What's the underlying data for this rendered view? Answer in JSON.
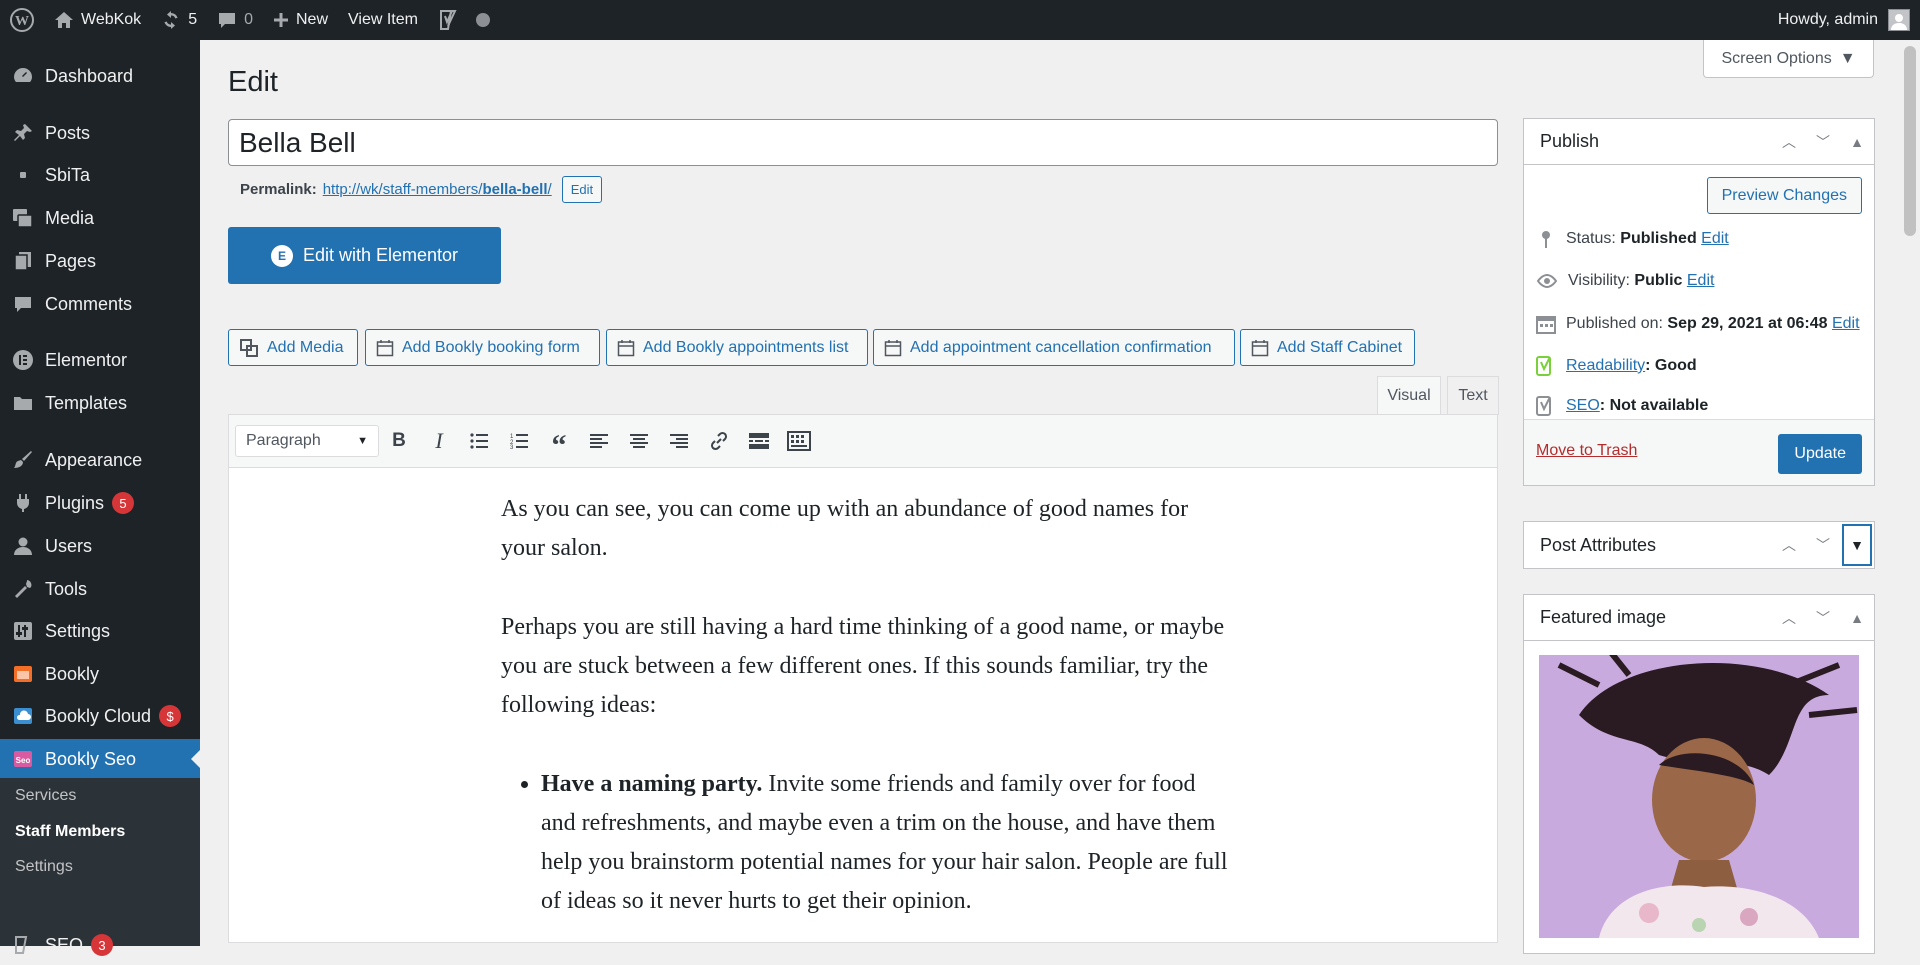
{
  "adminbar": {
    "site": "WebKok",
    "updates": "5",
    "comments": "0",
    "new_label": "New",
    "view_item": "View Item",
    "howdy": "Howdy, admin"
  },
  "sidebar": {
    "items": [
      {
        "label": "Dashboard",
        "icon": "dashboard-icon"
      },
      {
        "label": "Posts",
        "icon": "pin-icon"
      },
      {
        "label": "SbiTa",
        "icon": "dot-icon"
      },
      {
        "label": "Media",
        "icon": "media-icon"
      },
      {
        "label": "Pages",
        "icon": "pages-icon"
      },
      {
        "label": "Comments",
        "icon": "comment-icon"
      },
      {
        "label": "Elementor",
        "icon": "elementor-icon"
      },
      {
        "label": "Templates",
        "icon": "folder-icon"
      },
      {
        "label": "Appearance",
        "icon": "brush-icon"
      },
      {
        "label": "Plugins",
        "icon": "plug-icon",
        "badge": "5"
      },
      {
        "label": "Users",
        "icon": "user-icon"
      },
      {
        "label": "Tools",
        "icon": "wrench-icon"
      },
      {
        "label": "Settings",
        "icon": "settings-icon"
      },
      {
        "label": "Bookly",
        "icon": "bookly-icon"
      },
      {
        "label": "Bookly Cloud",
        "icon": "cloud-icon",
        "badge": "$"
      },
      {
        "label": "Bookly Seo",
        "icon": "seo-icon"
      },
      {
        "label": "SEO",
        "icon": "yoast-icon",
        "badge": "3"
      }
    ],
    "submenu": [
      "Services",
      "Staff Members",
      "Settings"
    ]
  },
  "main": {
    "screen_options": "Screen Options",
    "page_title": "Edit",
    "post_title": "Bella Bell",
    "permalink_label": "Permalink:",
    "permalink_base": "http://wk/staff-members/",
    "permalink_slug": "bella-bell",
    "permalink_end": "/",
    "permalink_edit": "Edit",
    "elementor_btn": "Edit with Elementor",
    "media_buttons": [
      "Add Media",
      "Add Bookly booking form",
      "Add Bookly appointments list",
      "Add appointment cancellation confirmation",
      "Add Staff Cabinet"
    ],
    "tab_visual": "Visual",
    "tab_text": "Text",
    "format_select": "Paragraph",
    "content": {
      "p1": "As you can see, you can come up with an abundance of good names for your salon.",
      "p2": "Perhaps you are still having a hard time thinking of a good name, or maybe you are stuck between a few different ones. If this sounds familiar, try the following ideas:",
      "li1_bold": "Have a naming party.",
      "li1_rest": " Invite some friends and family over for food and refreshments, and maybe even a trim on the house, and have them help you brainstorm potential names for your hair salon. People are full of ideas so it never hurts to get their opinion."
    }
  },
  "publish": {
    "title": "Publish",
    "preview": "Preview Changes",
    "status_label": "Status:",
    "status_value": "Published",
    "visibility_label": "Visibility:",
    "visibility_value": "Public",
    "published_label": "Published on:",
    "published_value": "Sep 29, 2021 at 06:48",
    "edit": "Edit",
    "readability_link": "Readability",
    "readability_value": ": Good",
    "seo_link": "SEO",
    "seo_value": ": Not available",
    "trash": "Move to Trash",
    "update": "Update"
  },
  "attributes": {
    "title": "Post Attributes"
  },
  "featured": {
    "title": "Featured image"
  },
  "colors": {
    "accent": "#2271b1",
    "admin_dark": "#1d2327",
    "badge": "#d63638"
  }
}
